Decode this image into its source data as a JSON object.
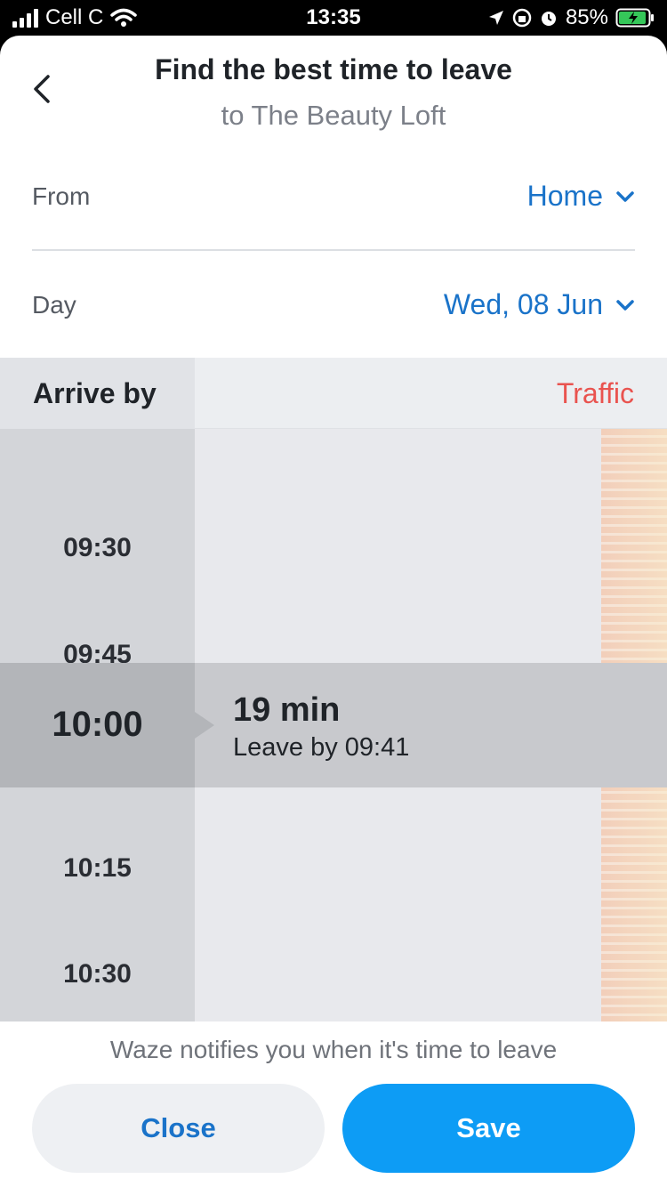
{
  "status_bar": {
    "carrier": "Cell C",
    "time": "13:35",
    "battery": "85%"
  },
  "header": {
    "title": "Find the best time to leave",
    "subtitle": "to The Beauty Loft"
  },
  "from": {
    "label": "From",
    "value": "Home"
  },
  "day": {
    "label": "Day",
    "value": "Wed, 08 Jun"
  },
  "planner": {
    "arrive_label": "Arrive by",
    "traffic_label": "Traffic",
    "times": [
      "09:30",
      "09:45",
      "10:15",
      "10:30"
    ],
    "selected": {
      "time": "10:00",
      "duration": "19 min",
      "leave_by": "Leave by 09:41"
    }
  },
  "footer": {
    "notice": "Waze notifies you when it's time to leave",
    "close_label": "Close",
    "save_label": "Save"
  },
  "colors": {
    "accent": "#1a73c9",
    "save_button": "#0d9cf5",
    "traffic": "#e9534f"
  },
  "icons": {
    "back": "chevron-left-icon",
    "dropdown": "chevron-down-icon"
  }
}
